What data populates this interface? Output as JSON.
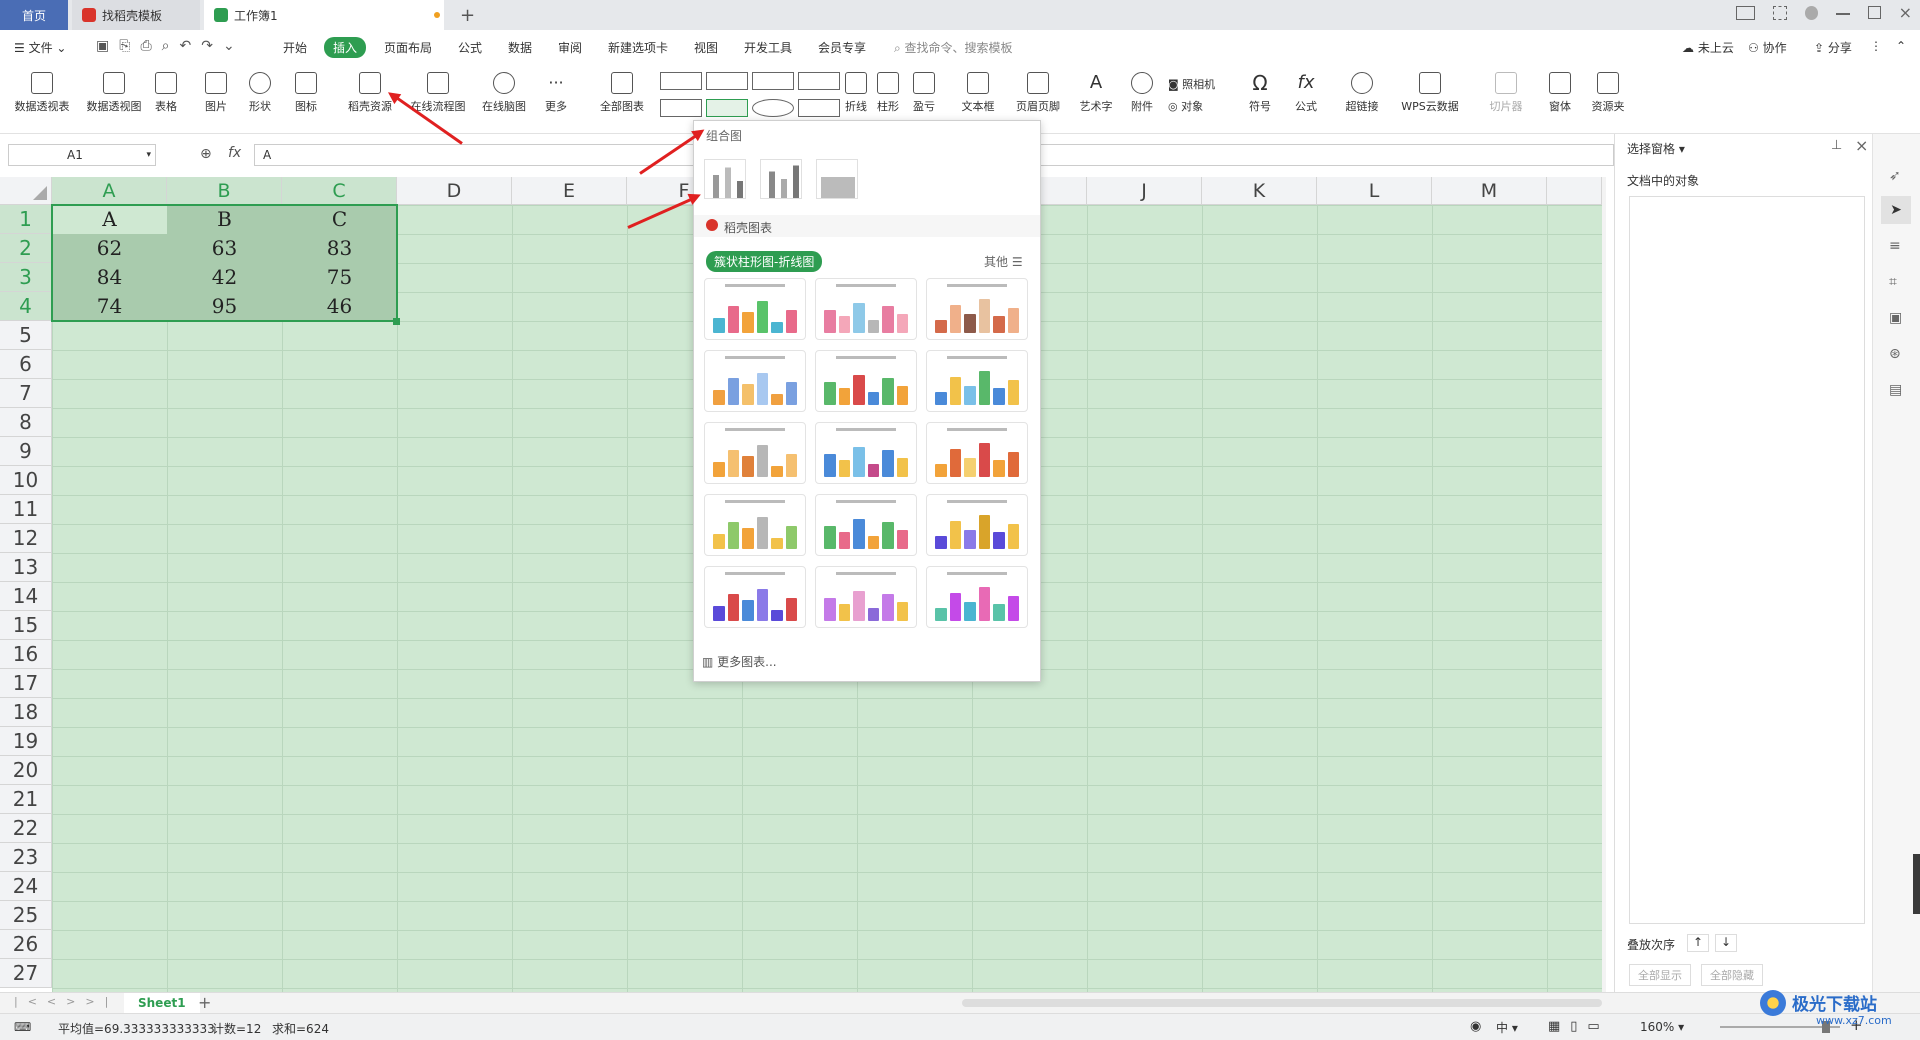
{
  "tabs": {
    "home": "首页",
    "template": "找稻壳模板",
    "workbook": "工作簿1",
    "new_tab": "+"
  },
  "menu": {
    "file": "文件",
    "items": [
      "开始",
      "插入",
      "页面布局",
      "公式",
      "数据",
      "审阅",
      "新建选项卡",
      "视图",
      "开发工具",
      "会员专享"
    ],
    "search_placeholder": "查找命令、搜索模板",
    "cloud": "未上云",
    "collab": "协作",
    "share": "分享"
  },
  "ribbon": {
    "row1": [
      "数据透视表",
      "数据透视图",
      "表格",
      "图片",
      "形状",
      "图标",
      "稻壳资源",
      "在线流程图",
      "在线脑图",
      "更多",
      "全部图表"
    ],
    "right": [
      "折线",
      "柱形",
      "盈亏",
      "文本框",
      "页眉页脚",
      "艺术字",
      "附件",
      "照相机",
      "对象",
      "符号",
      "公式",
      "超链接",
      "WPS云数据",
      "切片器",
      "窗体",
      "资源夹"
    ]
  },
  "formula": {
    "cell_ref": "A1",
    "fx": "fx",
    "value": "A"
  },
  "columns": [
    "A",
    "B",
    "C",
    "D",
    "E",
    "F",
    "G",
    "H",
    "I",
    "J",
    "K",
    "L",
    "M"
  ],
  "rows": [
    "1",
    "2",
    "3",
    "4",
    "5",
    "6",
    "7",
    "8",
    "9",
    "10",
    "11",
    "12",
    "13",
    "14",
    "15",
    "16",
    "17",
    "18",
    "19",
    "20",
    "21",
    "22",
    "23",
    "24",
    "25",
    "26",
    "27"
  ],
  "table": [
    [
      "A",
      "B",
      "C"
    ],
    [
      "62",
      "63",
      "83"
    ],
    [
      "84",
      "42",
      "75"
    ],
    [
      "74",
      "95",
      "46"
    ]
  ],
  "dropdown": {
    "section1": "组合图",
    "section2": "稻壳图表",
    "category": "簇状柱形图-折线图",
    "other": "其他",
    "more": "更多图表..."
  },
  "right_pane": {
    "title": "选择窗格",
    "subtitle": "文档中的对象",
    "order": "叠放次序",
    "show_all": "全部显示",
    "hide_all": "全部隐藏"
  },
  "sheet": {
    "name": "Sheet1",
    "add": "+"
  },
  "status": {
    "avg": "平均值=69.333333333333",
    "count": "计数=12",
    "sum": "求和=624",
    "zoom": "160%",
    "lang": "中"
  },
  "watermark": {
    "text": "极光下载站",
    "url": "www.xz7.com"
  },
  "colors": {
    "accent": "#2e9d51",
    "arrow": "#e02020",
    "grid_fill": "#cfe8d2"
  }
}
